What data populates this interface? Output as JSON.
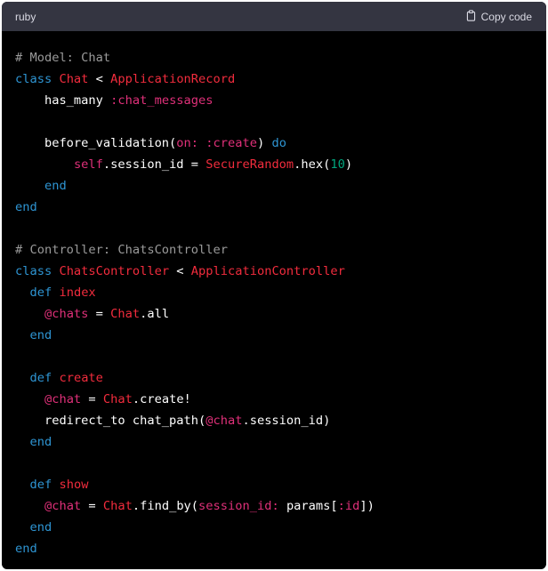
{
  "header": {
    "language": "ruby",
    "copy_label": "Copy code"
  },
  "code": {
    "lines": [
      [
        {
          "t": "# Model: Chat",
          "c": "c"
        }
      ],
      [
        {
          "t": "class",
          "c": "k"
        },
        {
          "t": " ",
          "c": "p"
        },
        {
          "t": "Chat",
          "c": "t"
        },
        {
          "t": " < ",
          "c": "p"
        },
        {
          "t": "ApplicationRecord",
          "c": "t"
        }
      ],
      [
        {
          "t": "    has_many ",
          "c": "p"
        },
        {
          "t": ":chat_messages",
          "c": "s"
        }
      ],
      [],
      [
        {
          "t": "    before_validation(",
          "c": "p"
        },
        {
          "t": "on:",
          "c": "s"
        },
        {
          "t": " ",
          "c": "p"
        },
        {
          "t": ":create",
          "c": "s"
        },
        {
          "t": ") ",
          "c": "p"
        },
        {
          "t": "do",
          "c": "k"
        }
      ],
      [
        {
          "t": "        ",
          "c": "p"
        },
        {
          "t": "self",
          "c": "s"
        },
        {
          "t": ".session_id = ",
          "c": "p"
        },
        {
          "t": "SecureRandom",
          "c": "t"
        },
        {
          "t": ".hex(",
          "c": "p"
        },
        {
          "t": "10",
          "c": "n"
        },
        {
          "t": ")",
          "c": "p"
        }
      ],
      [
        {
          "t": "    ",
          "c": "p"
        },
        {
          "t": "end",
          "c": "k"
        }
      ],
      [
        {
          "t": "end",
          "c": "k"
        }
      ],
      [],
      [
        {
          "t": "# Controller: ChatsController",
          "c": "c"
        }
      ],
      [
        {
          "t": "class",
          "c": "k"
        },
        {
          "t": " ",
          "c": "p"
        },
        {
          "t": "ChatsController",
          "c": "t"
        },
        {
          "t": " < ",
          "c": "p"
        },
        {
          "t": "ApplicationController",
          "c": "t"
        }
      ],
      [
        {
          "t": "  ",
          "c": "p"
        },
        {
          "t": "def",
          "c": "k"
        },
        {
          "t": " ",
          "c": "p"
        },
        {
          "t": "index",
          "c": "t"
        }
      ],
      [
        {
          "t": "    ",
          "c": "p"
        },
        {
          "t": "@chats",
          "c": "s"
        },
        {
          "t": " = ",
          "c": "p"
        },
        {
          "t": "Chat",
          "c": "t"
        },
        {
          "t": ".all",
          "c": "p"
        }
      ],
      [
        {
          "t": "  ",
          "c": "p"
        },
        {
          "t": "end",
          "c": "k"
        }
      ],
      [],
      [
        {
          "t": "  ",
          "c": "p"
        },
        {
          "t": "def",
          "c": "k"
        },
        {
          "t": " ",
          "c": "p"
        },
        {
          "t": "create",
          "c": "t"
        }
      ],
      [
        {
          "t": "    ",
          "c": "p"
        },
        {
          "t": "@chat",
          "c": "s"
        },
        {
          "t": " = ",
          "c": "p"
        },
        {
          "t": "Chat",
          "c": "t"
        },
        {
          "t": ".create!",
          "c": "p"
        }
      ],
      [
        {
          "t": "    redirect_to chat_path(",
          "c": "p"
        },
        {
          "t": "@chat",
          "c": "s"
        },
        {
          "t": ".session_id)",
          "c": "p"
        }
      ],
      [
        {
          "t": "  ",
          "c": "p"
        },
        {
          "t": "end",
          "c": "k"
        }
      ],
      [],
      [
        {
          "t": "  ",
          "c": "p"
        },
        {
          "t": "def",
          "c": "k"
        },
        {
          "t": " ",
          "c": "p"
        },
        {
          "t": "show",
          "c": "t"
        }
      ],
      [
        {
          "t": "    ",
          "c": "p"
        },
        {
          "t": "@chat",
          "c": "s"
        },
        {
          "t": " = ",
          "c": "p"
        },
        {
          "t": "Chat",
          "c": "t"
        },
        {
          "t": ".find_by(",
          "c": "p"
        },
        {
          "t": "session_id:",
          "c": "s"
        },
        {
          "t": " params[",
          "c": "p"
        },
        {
          "t": ":id",
          "c": "s"
        },
        {
          "t": "])",
          "c": "p"
        }
      ],
      [
        {
          "t": "  ",
          "c": "p"
        },
        {
          "t": "end",
          "c": "k"
        }
      ],
      [
        {
          "t": "end",
          "c": "k"
        }
      ]
    ]
  }
}
